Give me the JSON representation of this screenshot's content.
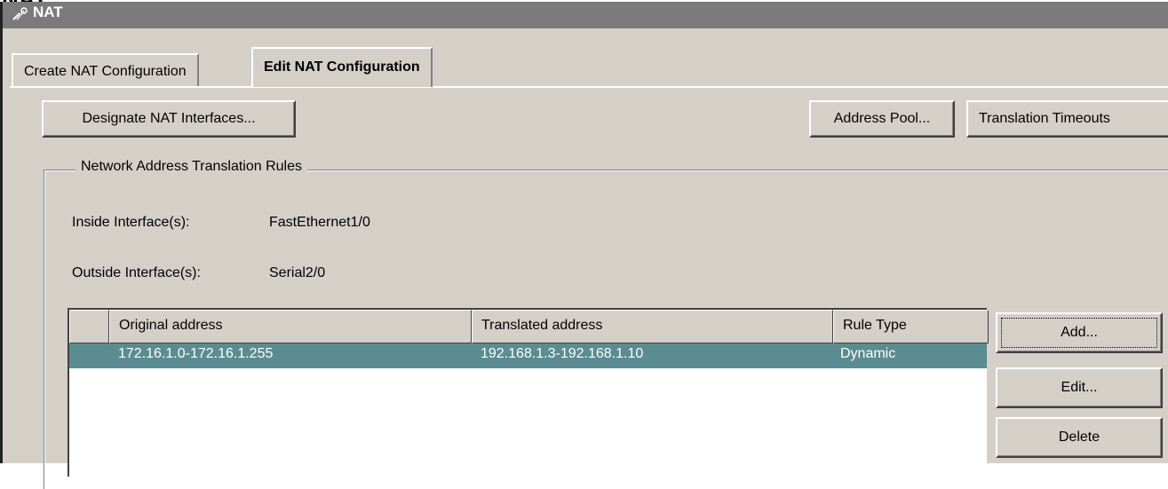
{
  "page": {
    "heading": "NAT"
  },
  "window": {
    "title": "NAT",
    "icon": "wrench-icon"
  },
  "tabs": [
    {
      "label": "Create NAT Configuration",
      "active": false
    },
    {
      "label": "Edit NAT Configuration",
      "active": true
    }
  ],
  "toolbar": {
    "designate_label": "Designate NAT Interfaces...",
    "pool_label": "Address Pool...",
    "timeouts_label": "Translation Timeouts"
  },
  "rules": {
    "group_title": "Network Address Translation Rules",
    "inside_label": "Inside Interface(s):",
    "inside_value": "FastEthernet1/0",
    "outside_label": "Outside Interface(s):",
    "outside_value": "Serial2/0",
    "columns": [
      "Original address",
      "Translated address",
      "Rule Type"
    ],
    "rows": [
      {
        "original": "172.16.1.0-172.16.1.255",
        "translated": "192.168.1.3-192.168.1.10",
        "type": "Dynamic",
        "selected": true
      }
    ],
    "selected_color": "#5a8c91"
  },
  "actions": {
    "add_label": "Add...",
    "edit_label": "Edit...",
    "delete_label": "Delete"
  }
}
